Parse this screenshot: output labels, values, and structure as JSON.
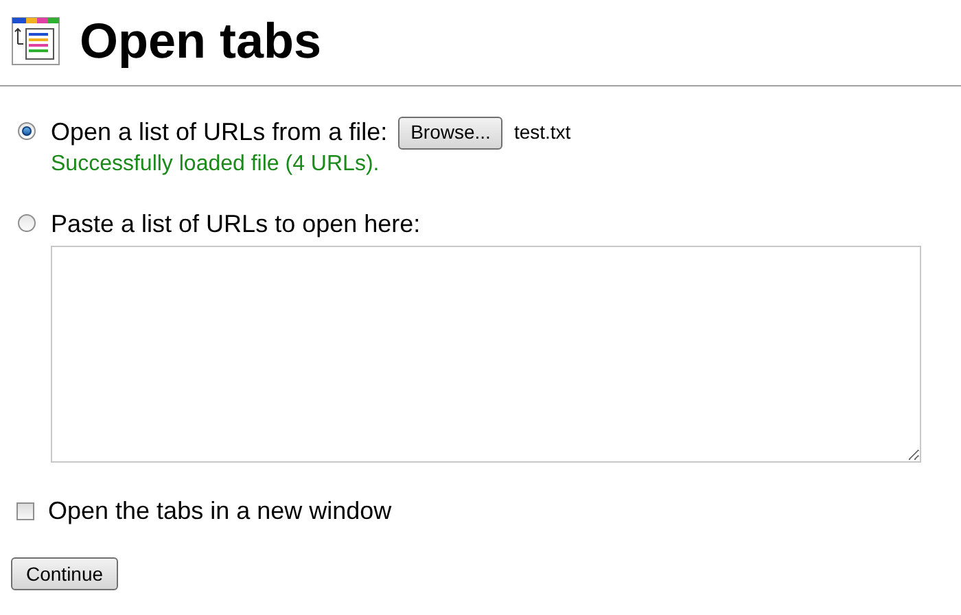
{
  "title": "Open tabs",
  "options": [
    {
      "label": "Open a list of URLs from a file:",
      "selected": true,
      "kind": "file"
    },
    {
      "label": "Paste a list of URLs to open here:",
      "selected": false,
      "kind": "paste"
    }
  ],
  "file": {
    "button": "Browse...",
    "filename": "test.txt",
    "status": "Successfully loaded file (4 URLs)."
  },
  "new_window": {
    "label": "Open the tabs in a new window",
    "checked": false
  },
  "submit": "Continue"
}
